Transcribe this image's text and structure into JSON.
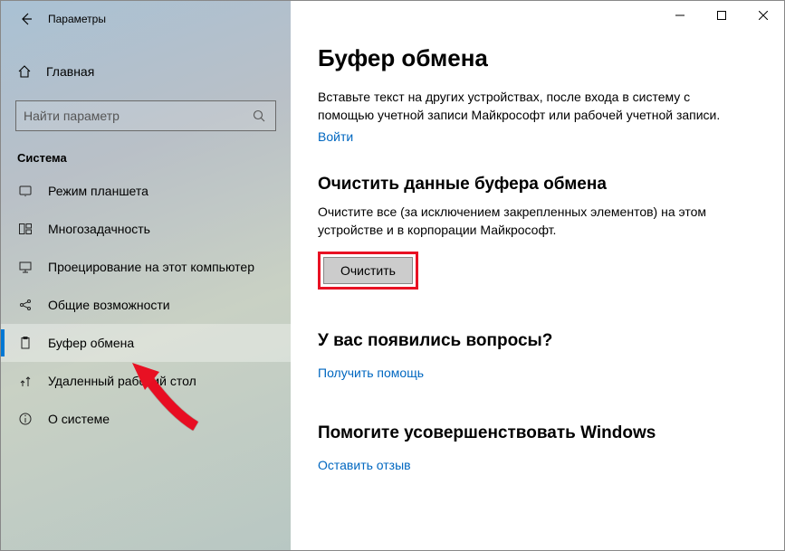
{
  "window": {
    "title": "Параметры"
  },
  "sidebar": {
    "home": "Главная",
    "search_placeholder": "Найти параметр",
    "category": "Система",
    "items": [
      {
        "label": "Режим планшета"
      },
      {
        "label": "Многозадачность"
      },
      {
        "label": "Проецирование на этот компьютер"
      },
      {
        "label": "Общие возможности"
      },
      {
        "label": "Буфер обмена"
      },
      {
        "label": "Удаленный рабочий стол"
      },
      {
        "label": "О системе"
      }
    ]
  },
  "main": {
    "title": "Буфер обмена",
    "intro": "Вставьте текст на других устройствах, после входа в систему с помощью учетной записи Майкрософт или рабочей учетной записи.",
    "signin_link": "Войти",
    "clear_heading": "Очистить данные буфера обмена",
    "clear_desc": "Очистите все (за исключением закрепленных элементов) на этом устройстве и в корпорации Майкрософт.",
    "clear_button": "Очистить",
    "questions_heading": "У вас появились вопросы?",
    "help_link": "Получить помощь",
    "improve_heading": "Помогите усовершенствовать Windows",
    "feedback_link": "Оставить отзыв"
  }
}
